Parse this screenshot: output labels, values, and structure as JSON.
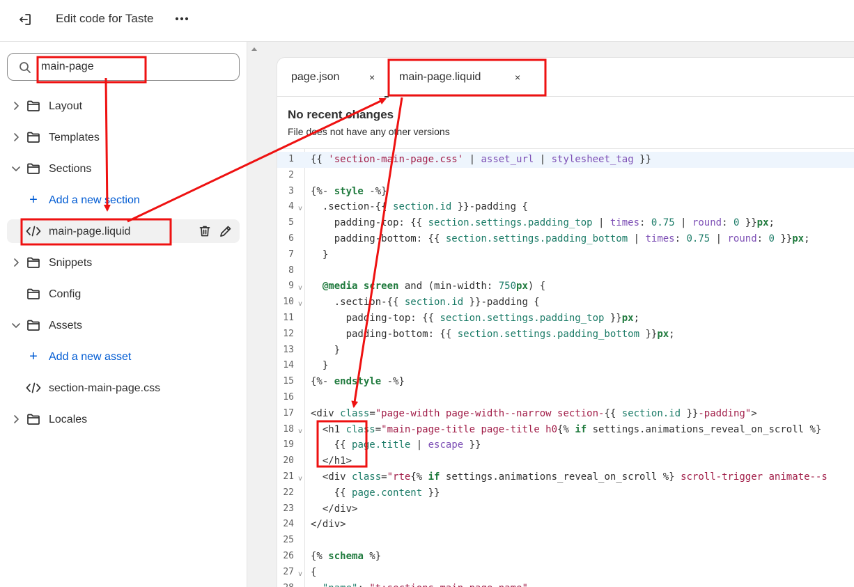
{
  "topbar": {
    "title": "Edit code for Taste"
  },
  "search": {
    "value": "main-page"
  },
  "sidebar": {
    "items": [
      {
        "label": "Layout"
      },
      {
        "label": "Templates"
      },
      {
        "label": "Sections"
      },
      {
        "label": "Add a new section"
      },
      {
        "label": "main-page.liquid"
      },
      {
        "label": "Snippets"
      },
      {
        "label": "Config"
      },
      {
        "label": "Assets"
      },
      {
        "label": "Add a new asset"
      },
      {
        "label": "section-main-page.css"
      },
      {
        "label": "Locales"
      }
    ]
  },
  "tabs": [
    {
      "label": "page.json",
      "close": "×"
    },
    {
      "label": "main-page.liquid",
      "close": "×"
    }
  ],
  "history": {
    "title": "No recent changes",
    "subtitle": "File does not have any other versions"
  },
  "code": {
    "line_numbers": [
      "1",
      "2",
      "3",
      "4",
      "5",
      "6",
      "7",
      "8",
      "9",
      "10",
      "11",
      "12",
      "13",
      "14",
      "15",
      "16",
      "17",
      "18",
      "19",
      "20",
      "21",
      "22",
      "23",
      "24",
      "25",
      "26",
      "27",
      "28"
    ],
    "fold_marker": "v"
  },
  "colors": {
    "annotation": "#ee1111",
    "link": "#005bd3"
  }
}
